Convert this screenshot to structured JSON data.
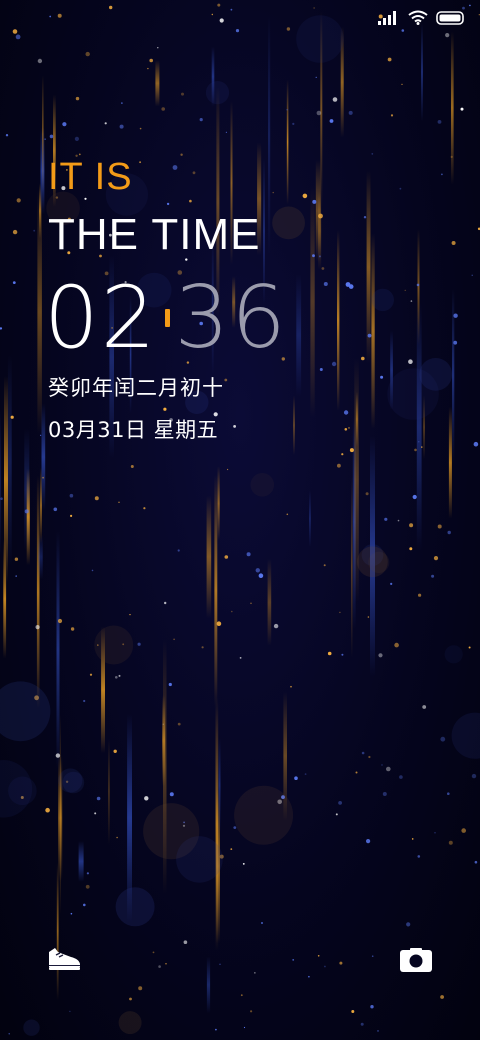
{
  "status_bar": {
    "signal_icon": "signal-bars-icon",
    "wifi_icon": "wifi-icon",
    "battery_icon": "battery-icon"
  },
  "lockscreen": {
    "headline_line1": "IT IS",
    "headline_line2": "THE TIME",
    "clock_hours": "02",
    "clock_minutes": "36",
    "lunar_date": "癸卯年闰二月初十",
    "date": "03月31日 星期五"
  },
  "shortcuts": {
    "left_icon": "sneaker-icon",
    "right_icon": "camera-icon"
  },
  "colors": {
    "accent": "#f39b18",
    "background": "#05051f",
    "minutes": "#9b9cad"
  }
}
